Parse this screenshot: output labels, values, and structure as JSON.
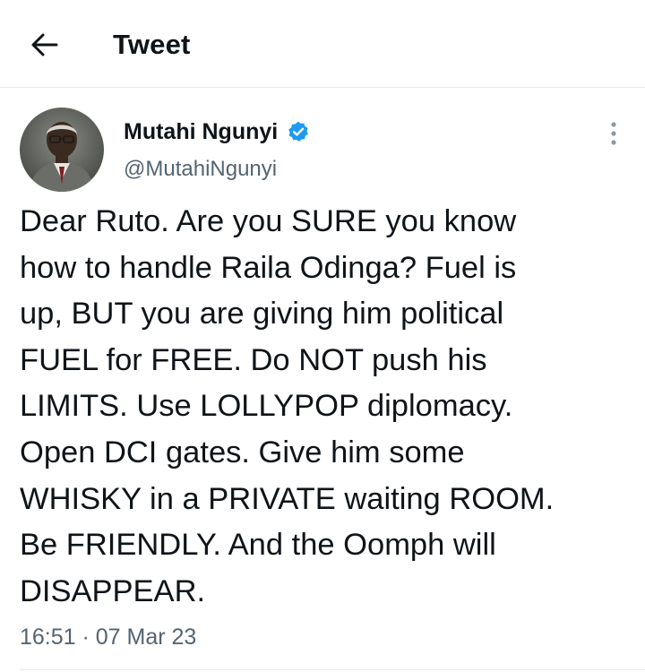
{
  "header": {
    "title": "Tweet",
    "back_icon": "arrow-left-icon"
  },
  "author": {
    "name": "Mutahi Ngunyi",
    "handle": "@MutahiNgunyi",
    "verified_icon": "verified-badge-icon",
    "verified_color": "#1d9bf0"
  },
  "more_icon": "more-vertical-icon",
  "tweet": {
    "text": "Dear Ruto. Are you SURE you know\nhow to handle Raila Odinga? Fuel is\nup, BUT you are giving him political\nFUEL for FREE. Do NOT push his\nLIMITS. Use LOLLYPOP diplomacy.\nOpen DCI gates. Give him some\nWHISKY in a PRIVATE waiting ROOM.\nBe FRIENDLY. And the Oomph will\nDISAPPEAR.",
    "timestamp": "16:51 · 07 Mar 23"
  },
  "colors": {
    "text": "#0f1419",
    "secondary": "#536471",
    "divider": "#e6e9eb"
  }
}
